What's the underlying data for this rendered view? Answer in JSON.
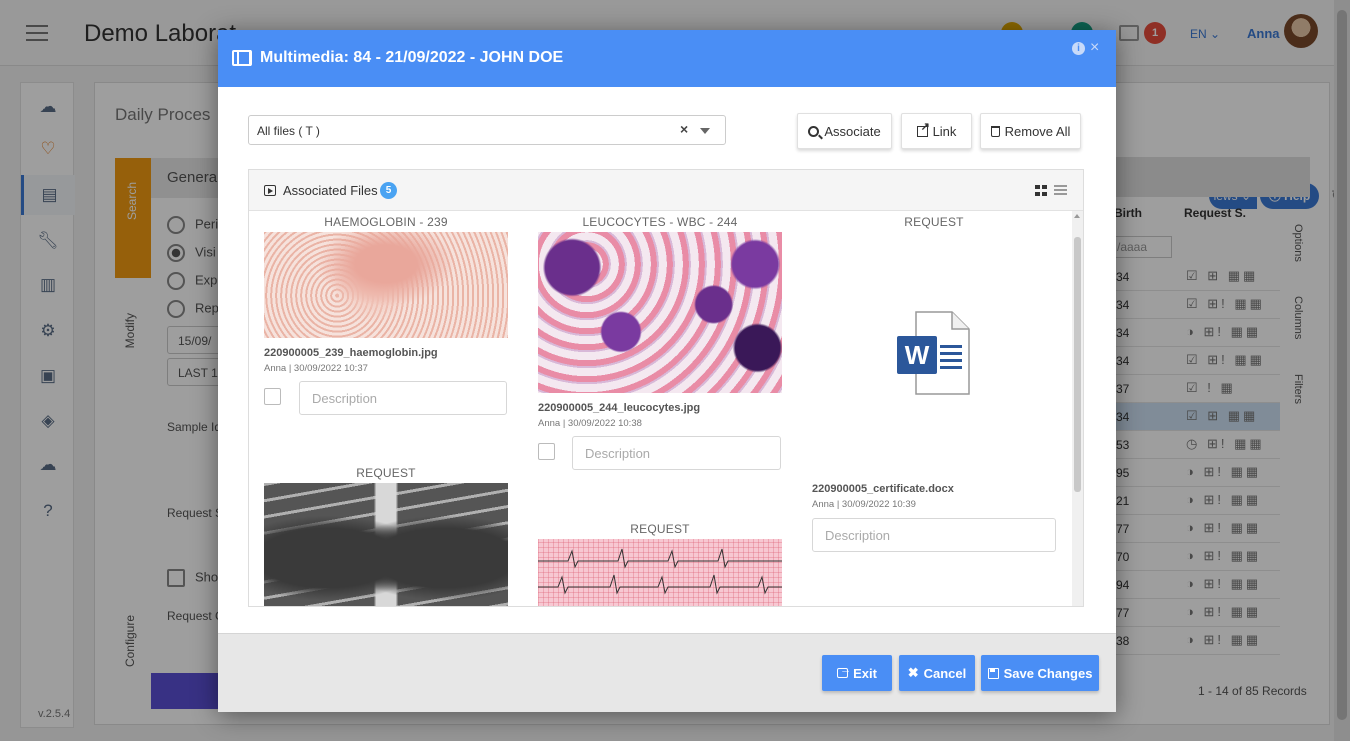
{
  "app": {
    "title": "Demo Laborat",
    "notification_count": "1",
    "language": "EN",
    "user": "Anna",
    "version": "v.2.5.4",
    "panel_title": "Daily Proces",
    "side_tabs": [
      "Search",
      "Modify",
      "Configure"
    ],
    "general_header": "General",
    "radio_options": [
      "Peri",
      "Visi",
      "Expe",
      "Repo"
    ],
    "date_field": "15/09/",
    "last_field": "LAST 1",
    "sample_label": "Sample Id",
    "request_label": "Request S",
    "show_label": "Sho",
    "request_g_label": "Request G",
    "views_label": "iews",
    "help_label": "Help",
    "grid": {
      "col_birth": "Birth",
      "col_request": "Request S.",
      "date_filter_placeholder": "/aaaa",
      "rows": [
        "34",
        "34",
        "34",
        "34",
        "37",
        "34",
        "53",
        "95",
        "21",
        "77",
        "70",
        "94",
        "77",
        "38"
      ],
      "right_labels": [
        "Options",
        "Columns",
        "Filters"
      ],
      "records": "1 - 14 of 85 Records"
    }
  },
  "modal": {
    "title": "Multimedia: 84 - 21/09/2022 - JOHN DOE",
    "file_filter": {
      "value": "All files ( T )"
    },
    "buttons": {
      "associate": "Associate",
      "link": "Link",
      "remove_all": "Remove All"
    },
    "associated_files": {
      "title": "Associated Files",
      "count": "5",
      "files": [
        {
          "category": "HAEMOGLOBIN - 239",
          "filename": "220900005_239_haemoglobin.jpg",
          "meta": "Anna | 30/09/2022 10:37",
          "description_placeholder": "Description"
        },
        {
          "category": "LEUCOCYTES - WBC - 244",
          "filename": "220900005_244_leucocytes.jpg",
          "meta": "Anna | 30/09/2022 10:38",
          "description_placeholder": "Description"
        },
        {
          "category": "REQUEST",
          "filename": "220900005_certificate.docx",
          "meta": "Anna | 30/09/2022 10:39",
          "description_placeholder": "Description",
          "icon": "word-doc-icon",
          "icon_letter": "W"
        },
        {
          "category": "REQUEST"
        },
        {
          "category": "REQUEST"
        }
      ]
    },
    "footer": {
      "exit": "Exit",
      "cancel": "Cancel",
      "save": "Save Changes"
    }
  },
  "colors": {
    "modal_header": "#4a8ef5",
    "primary_button": "#4a8ef5",
    "badge": "#4aa3f2",
    "search_tab": "#f39c12",
    "notification": "#e74c3c",
    "word_blue": "#2b579a"
  }
}
